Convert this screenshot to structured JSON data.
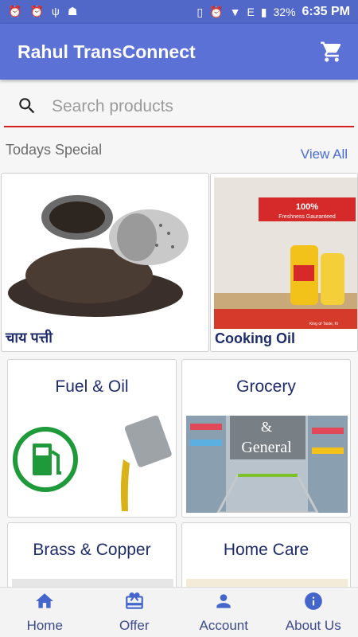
{
  "status_bar": {
    "battery": "32%",
    "time": "6:35 PM",
    "network": "E"
  },
  "app_bar": {
    "title": "Rahul TransConnect"
  },
  "search": {
    "placeholder": "Search products"
  },
  "specials": {
    "title": "Todays Special",
    "view_all": "View All",
    "items": [
      {
        "label": "चाय पत्ती"
      },
      {
        "label": "Cooking Oil",
        "banner": "100%",
        "banner_sub": "Freshness Gauranteed",
        "tagline": "King of Taste, Ki"
      }
    ]
  },
  "categories": [
    {
      "title": "Fuel & Oil"
    },
    {
      "title": "Grocery",
      "overlay_line1": "&",
      "overlay_line2": "General"
    },
    {
      "title": "Brass & Copper"
    },
    {
      "title": "Home Care"
    }
  ],
  "bottom_nav": [
    {
      "label": "Home",
      "icon": "home-icon"
    },
    {
      "label": "Offer",
      "icon": "gift-icon"
    },
    {
      "label": "Account",
      "icon": "person-icon"
    },
    {
      "label": "About Us",
      "icon": "info-icon"
    }
  ],
  "colors": {
    "primary": "#5c71d6",
    "search_underline": "#d62020",
    "nav_text": "#3c4a8c"
  }
}
